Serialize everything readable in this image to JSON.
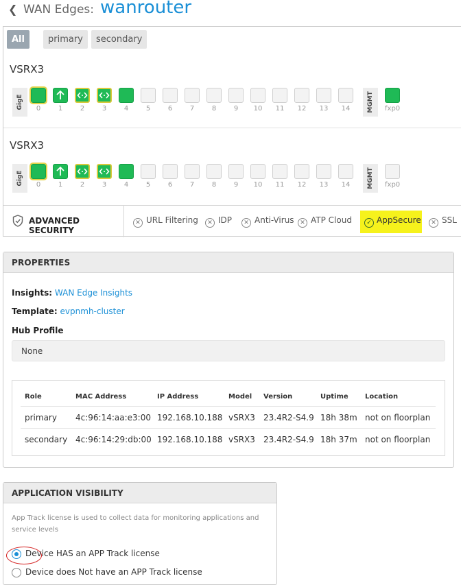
{
  "header": {
    "back_icon": "chevron-left-icon",
    "breadcrumb": "WAN Edges:",
    "title": "wanrouter"
  },
  "filters": [
    {
      "label": "All",
      "active": true
    },
    {
      "label": "primary",
      "active": false
    },
    {
      "label": "secondary",
      "active": false
    }
  ],
  "devices": [
    {
      "name": "VSRX3",
      "gige_label": "GigE",
      "mgmt_label": "MGMT",
      "ports": [
        "0",
        "1",
        "2",
        "3",
        "4",
        "5",
        "6",
        "7",
        "8",
        "9",
        "10",
        "11",
        "12",
        "13",
        "14"
      ],
      "mgmt_port": "fxp0",
      "port_states": [
        "up-selected",
        "uplink",
        "swap",
        "swap",
        "up",
        "empty",
        "empty",
        "empty",
        "empty",
        "empty",
        "empty",
        "empty",
        "empty",
        "empty",
        "empty"
      ],
      "mgmt_state": "up"
    },
    {
      "name": "VSRX3",
      "gige_label": "GigE",
      "mgmt_label": "MGMT",
      "ports": [
        "0",
        "1",
        "2",
        "3",
        "4",
        "5",
        "6",
        "7",
        "8",
        "9",
        "10",
        "11",
        "12",
        "13",
        "14"
      ],
      "mgmt_port": "fxp0",
      "port_states": [
        "up-selected",
        "uplink",
        "swap",
        "swap",
        "up",
        "empty",
        "empty",
        "empty",
        "empty",
        "empty",
        "empty",
        "empty",
        "empty",
        "empty",
        "empty"
      ],
      "mgmt_state": "empty"
    }
  ],
  "security": {
    "heading": "ADVANCED SECURITY",
    "items": [
      {
        "label": "URL Filtering",
        "enabled": false
      },
      {
        "label": "IDP",
        "enabled": false
      },
      {
        "label": "Anti-Virus",
        "enabled": false
      },
      {
        "label": "ATP Cloud",
        "enabled": false
      },
      {
        "label": "AppSecure",
        "enabled": true,
        "highlight": "#f6f21c"
      },
      {
        "label": "SSL",
        "enabled": false
      }
    ]
  },
  "properties": {
    "heading": "PROPERTIES",
    "insights_label": "Insights:",
    "insights_link": "WAN Edge Insights",
    "template_label": "Template:",
    "template_link": "evpnmh-cluster",
    "hub_profile_label": "Hub Profile",
    "hub_profile_value": "None",
    "table": {
      "columns": [
        "Role",
        "MAC Address",
        "IP Address",
        "Model",
        "Version",
        "Uptime",
        "Location"
      ],
      "rows": [
        [
          "primary",
          "4c:96:14:aa:e3:00",
          "192.168.10.188",
          "vSRX3",
          "23.4R2-S4.9",
          "18h 38m",
          "not on floorplan"
        ],
        [
          "secondary",
          "4c:96:14:29:db:00",
          "192.168.10.188",
          "vSRX3",
          "23.4R2-S4.9",
          "18h 37m",
          "not on floorplan"
        ]
      ]
    }
  },
  "app_visibility": {
    "heading": "APPLICATION VISIBILITY",
    "description": "App Track license is used to collect data for monitoring applications and service levels",
    "options": [
      {
        "label": "Device HAS an APP Track license",
        "selected": true
      },
      {
        "label": "Device does Not have an APP Track license",
        "selected": false
      }
    ]
  },
  "colors": {
    "accent": "#1a8fd6",
    "port_up": "#1fba56",
    "highlight": "#f6f21c",
    "annotation": "#d42020"
  }
}
